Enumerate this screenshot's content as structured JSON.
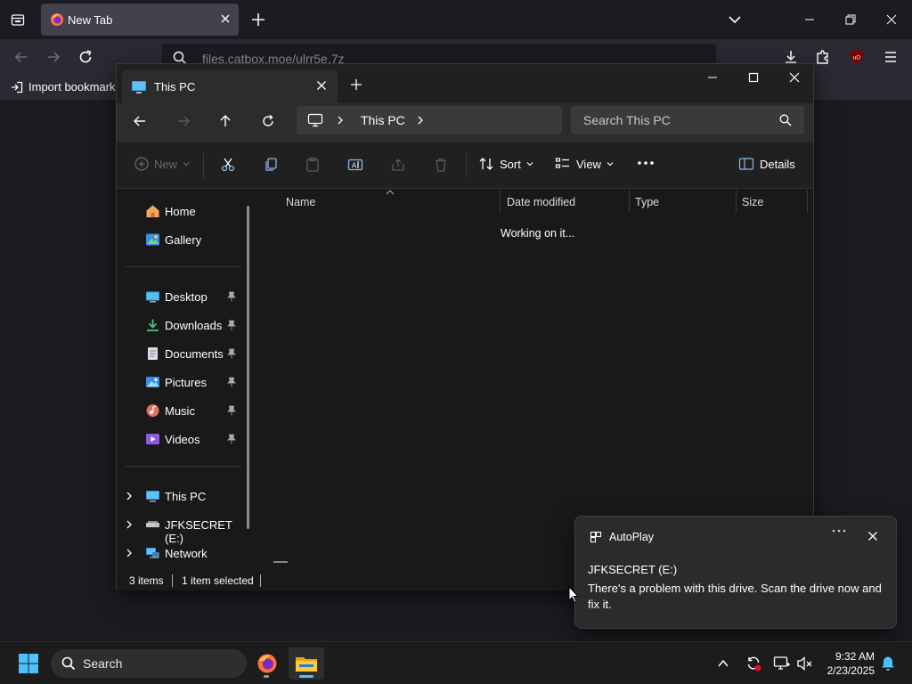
{
  "browser": {
    "tab": {
      "title": "New Tab"
    },
    "url": "files.catbox.moe/ulrr5e.7z",
    "bookmarks": {
      "import_label": "Import bookmarks..."
    }
  },
  "explorer": {
    "tab": {
      "title": "This PC"
    },
    "breadcrumb": {
      "location": "This PC"
    },
    "search": {
      "placeholder": "Search This PC"
    },
    "commands": {
      "new": "New",
      "sort": "Sort",
      "view": "View",
      "details": "Details"
    },
    "nav": {
      "quick": [
        {
          "label": "Home",
          "icon": "home-icon"
        },
        {
          "label": "Gallery",
          "icon": "gallery-icon"
        }
      ],
      "pinned": [
        {
          "label": "Desktop",
          "icon": "desktop-folder-icon"
        },
        {
          "label": "Downloads",
          "icon": "downloads-folder-icon"
        },
        {
          "label": "Documents",
          "icon": "documents-folder-icon"
        },
        {
          "label": "Pictures",
          "icon": "pictures-folder-icon"
        },
        {
          "label": "Music",
          "icon": "music-folder-icon"
        },
        {
          "label": "Videos",
          "icon": "videos-folder-icon"
        }
      ],
      "tree": [
        {
          "label": "This PC",
          "icon": "this-pc-icon"
        },
        {
          "label": "JFKSECRET (E:)",
          "icon": "drive-icon"
        },
        {
          "label": "Network",
          "icon": "network-icon"
        }
      ]
    },
    "columns": [
      "Name",
      "Date modified",
      "Type",
      "Size"
    ],
    "loading_text": "Working on it...",
    "status": {
      "items": "3 items",
      "selected": "1 item selected"
    }
  },
  "toast": {
    "app_name": "AutoPlay",
    "heading": "JFKSECRET (E:)",
    "message": "There's a problem with this drive.  Scan the drive now and fix it."
  },
  "taskbar": {
    "search_placeholder": "Search",
    "time": "9:32 AM",
    "date": "2/23/2025"
  },
  "colors": {
    "accent": "#4cc2ff",
    "firefox_orange": "#ff7139",
    "ublock_red": "#800000"
  }
}
